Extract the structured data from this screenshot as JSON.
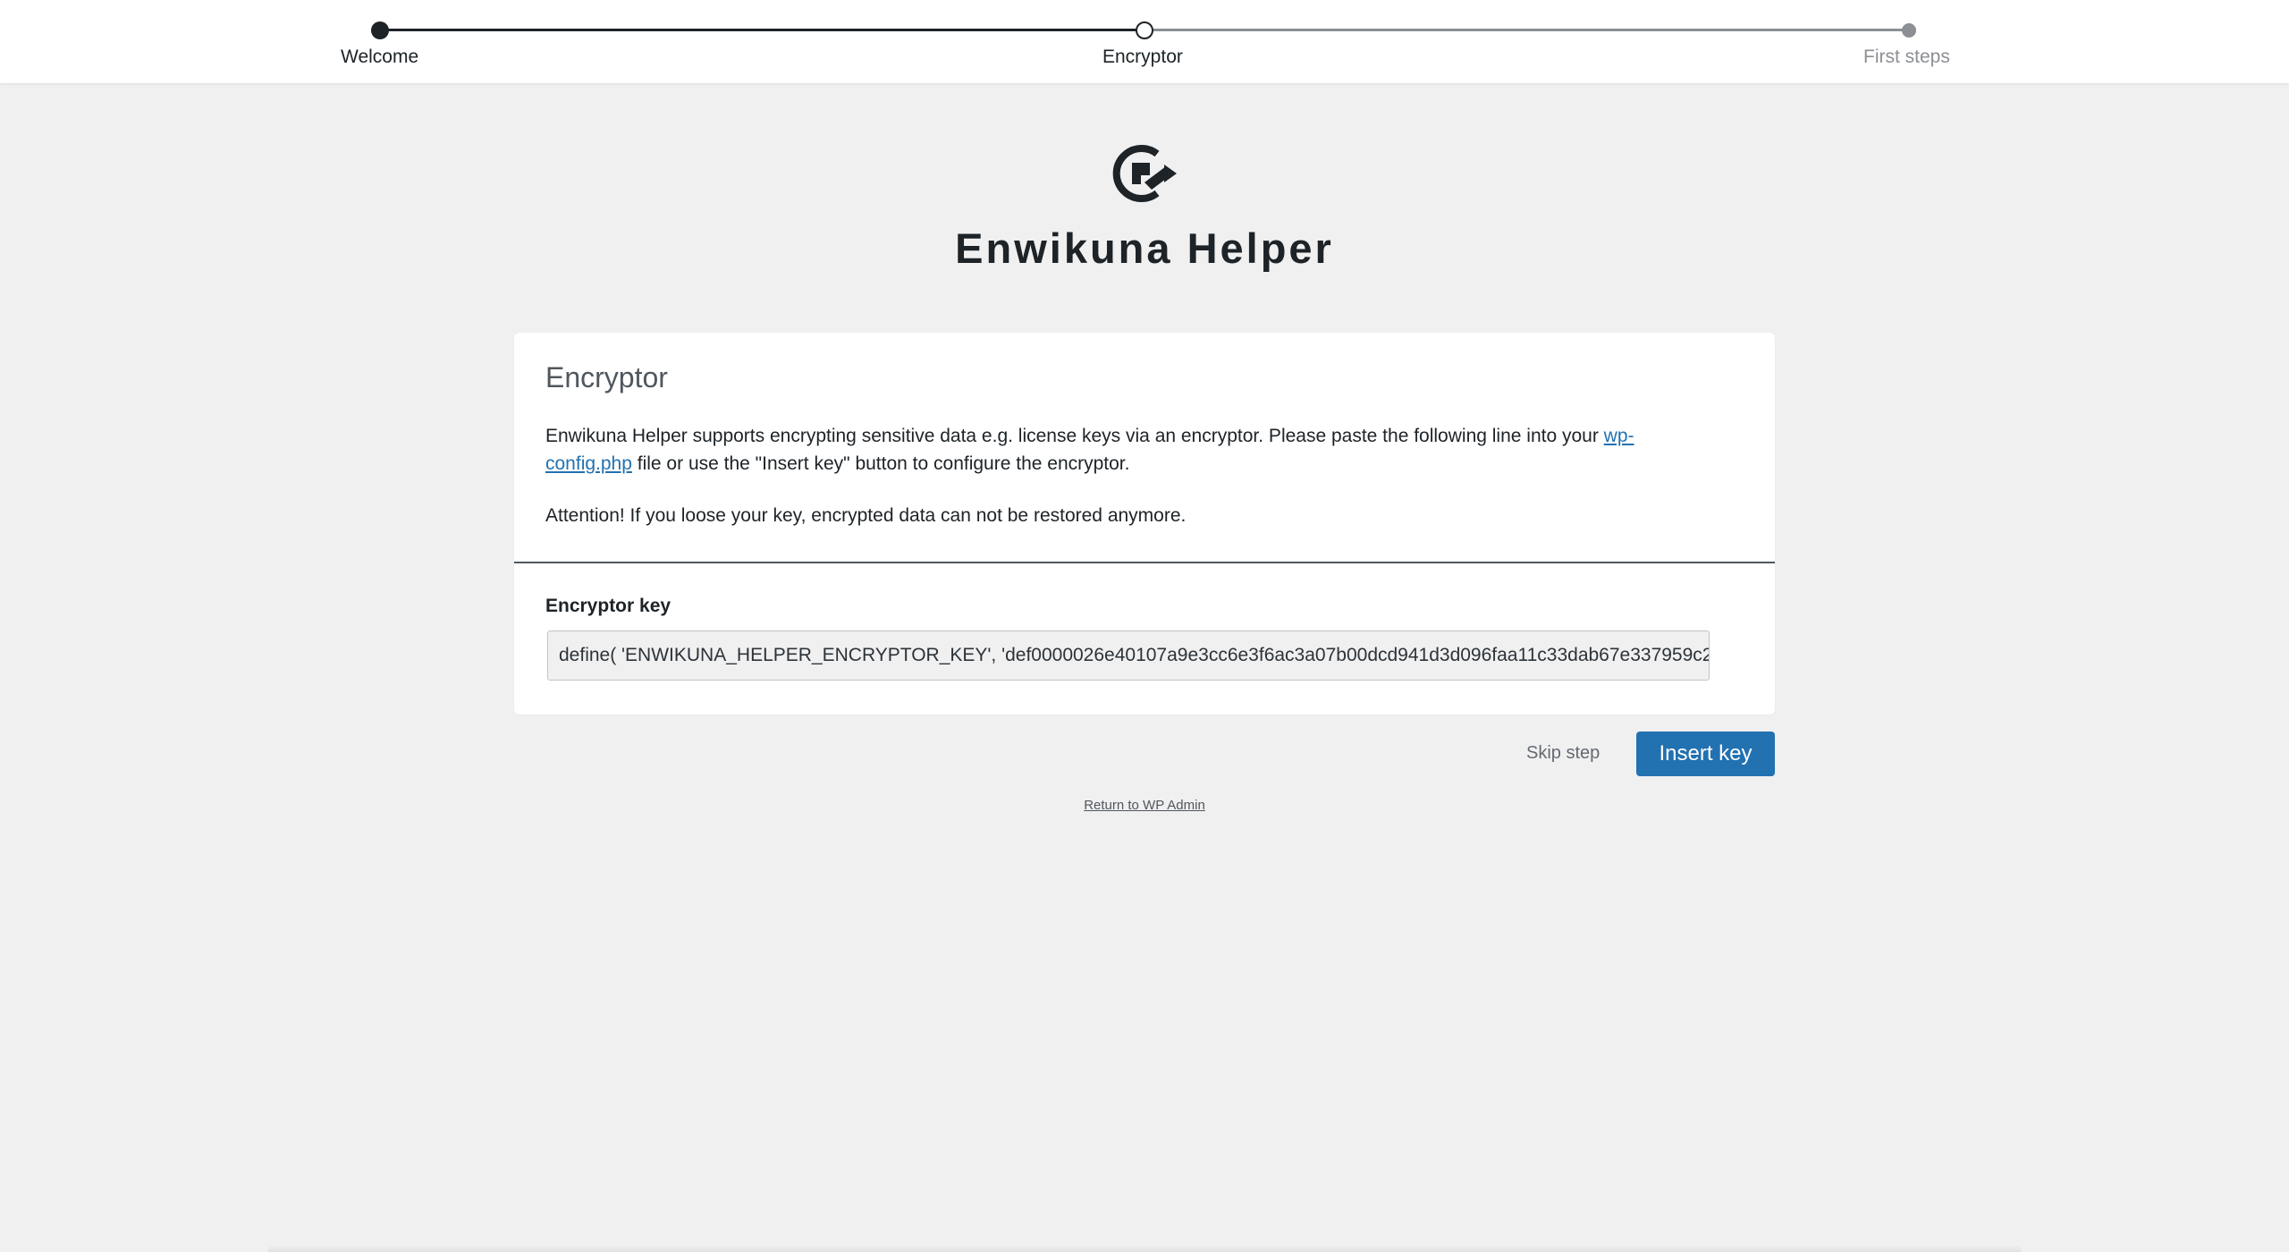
{
  "steps": [
    {
      "label": "Welcome",
      "state": "done"
    },
    {
      "label": "Encryptor",
      "state": "current"
    },
    {
      "label": "First steps",
      "state": "todo"
    }
  ],
  "app": {
    "title": "Enwikuna Helper",
    "logo_icon": "enwikuna-logo-icon"
  },
  "card": {
    "title": "Encryptor",
    "text_before_link": "Enwikuna Helper supports encrypting sensitive data e.g. license keys via an encryptor. Please paste the following line into your ",
    "link_text": "wp-config.php",
    "text_after_link": " file or use the \"Insert key\" button to configure the encryptor.",
    "warning": "Attention! If you loose your key, encrypted data can not be restored anymore.",
    "key_label": "Encryptor key",
    "key_value": "define( 'ENWIKUNA_HELPER_ENCRYPTOR_KEY', 'def0000026e40107a9e3cc6e3f6ac3a07b00dcd941d3d096faa11c33dab67e337959c2"
  },
  "actions": {
    "skip_label": "Skip step",
    "insert_label": "Insert key",
    "return_label": "Return to WP Admin"
  },
  "colors": {
    "primary": "#2271b1",
    "text": "#1d2327",
    "muted": "#8c8f94",
    "background": "#f0f0f1"
  }
}
